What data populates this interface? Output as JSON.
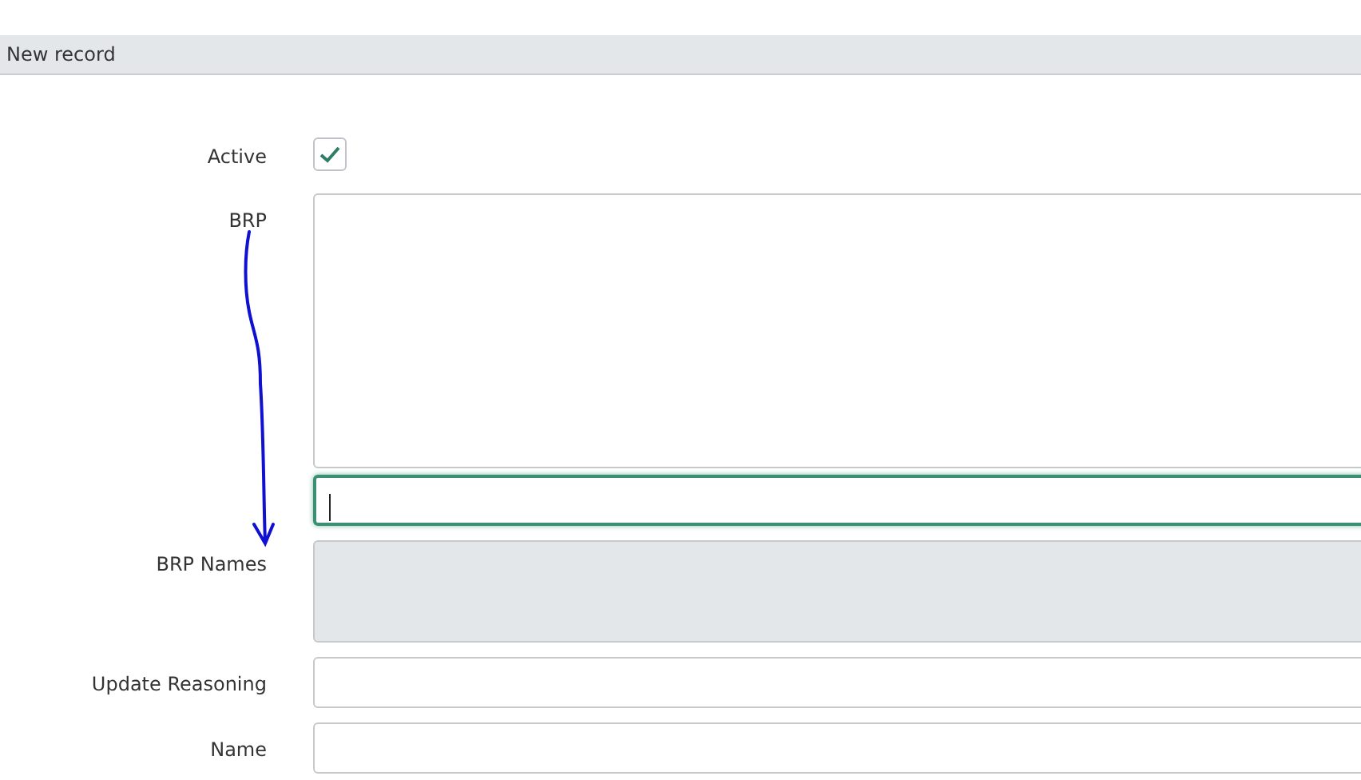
{
  "header": {
    "title": "New record"
  },
  "fields": [
    {
      "kind": "checkbox",
      "label": "Active",
      "checked": true
    },
    {
      "kind": "listbox",
      "label": "BRP",
      "focused": true
    },
    {
      "kind": "readonly",
      "label": "BRP Names"
    },
    {
      "kind": "text",
      "label": "Update Reasoning"
    },
    {
      "kind": "text",
      "label": "Name"
    }
  ]
}
